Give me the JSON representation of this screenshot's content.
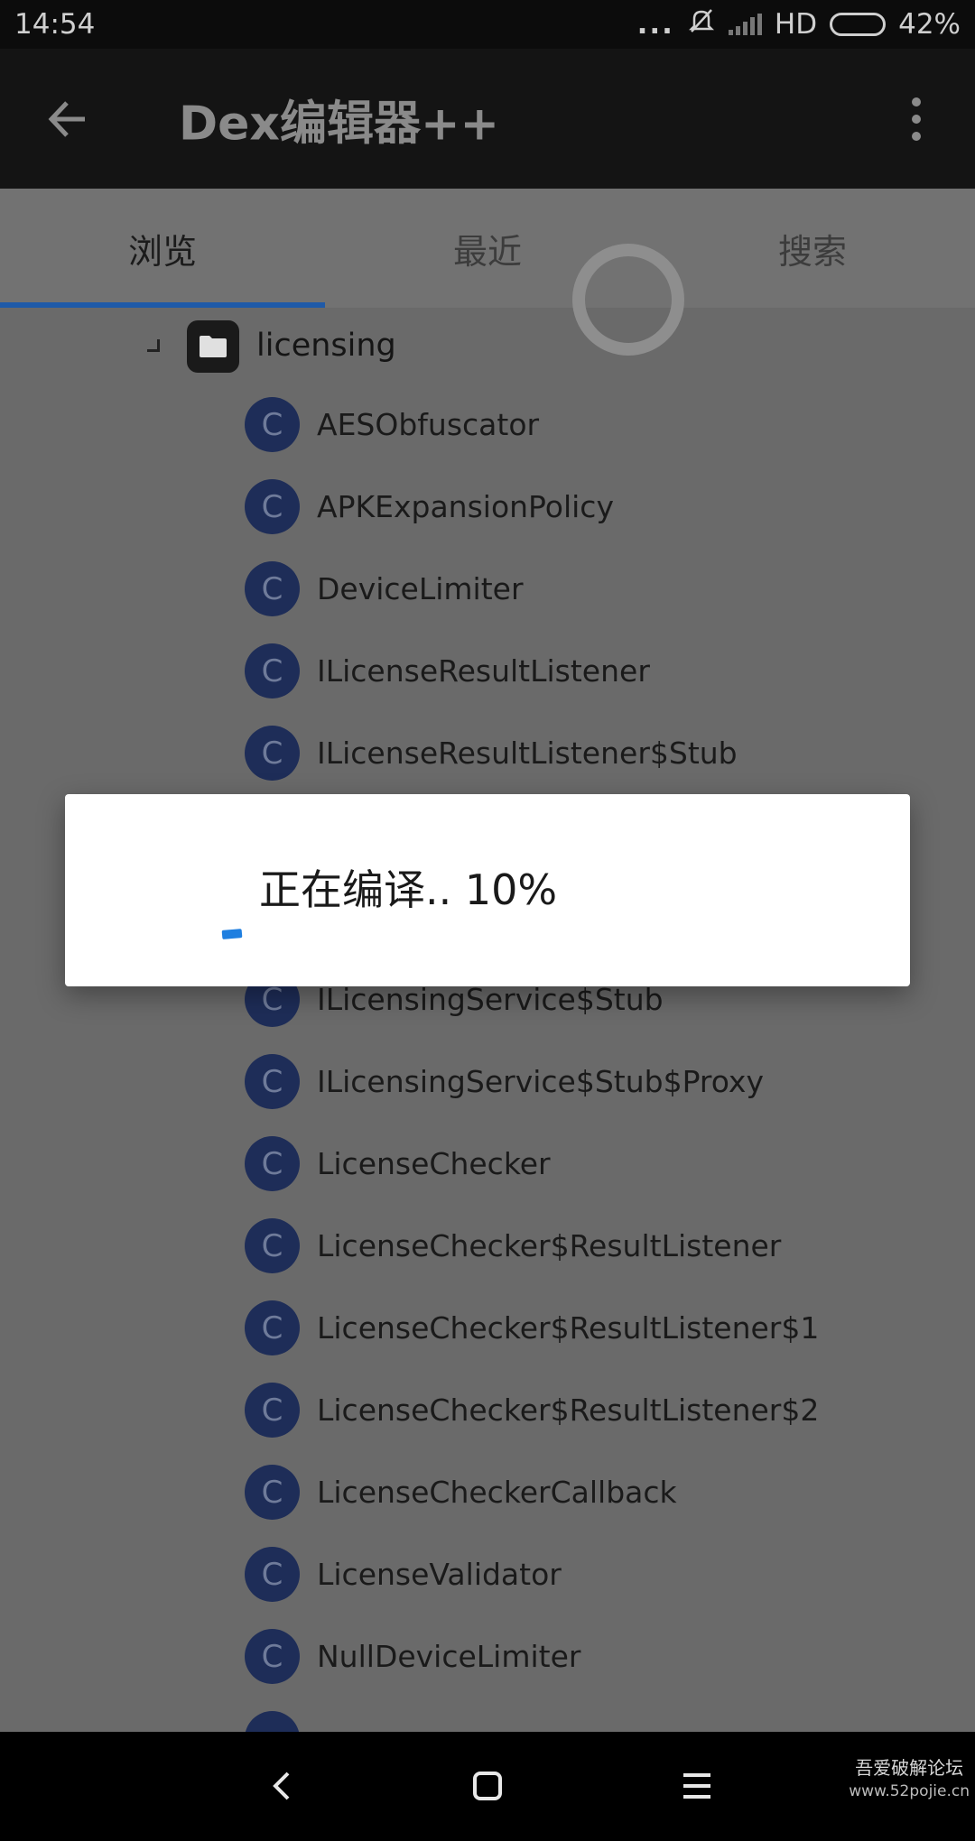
{
  "status_bar": {
    "time": "14:54",
    "dots": "...",
    "network": "HD",
    "battery": "42%",
    "battery_level": 0.42
  },
  "app_bar": {
    "title": "Dex编辑器++",
    "back_icon": "arrow-back-icon",
    "more_icon": "more-vert-icon"
  },
  "tabs": [
    {
      "label": "浏览",
      "active": true
    },
    {
      "label": "最近",
      "active": false
    },
    {
      "label": "搜索",
      "active": false
    }
  ],
  "tree": {
    "folder": "licensing",
    "class_badge": "C",
    "classes": [
      "AESObfuscator",
      "APKExpansionPolicy",
      "DeviceLimiter",
      "ILicenseResultListener",
      "ILicenseResultListener$Stub",
      "",
      "",
      "ILicensingService$Stub",
      "ILicensingService$Stub$Proxy",
      "LicenseChecker",
      "LicenseChecker$ResultListener",
      "LicenseChecker$ResultListener$1",
      "LicenseChecker$ResultListener$2",
      "LicenseCheckerCallback",
      "LicenseValidator",
      "NullDeviceLimiter"
    ]
  },
  "dialog": {
    "text": "正在编译.. 10%",
    "progress_percent": 10
  },
  "watermark": {
    "name": "吾爱破解论坛",
    "url": "www.52pojie.cn"
  }
}
